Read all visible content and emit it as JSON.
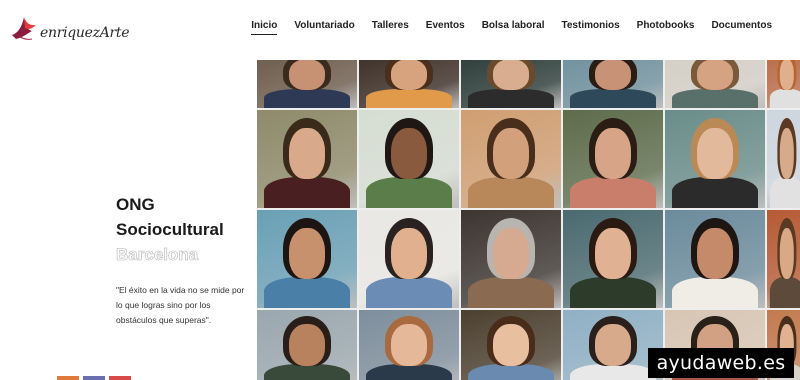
{
  "brand": {
    "name": "enriquezArte"
  },
  "nav": {
    "items": [
      {
        "label": "Inicio",
        "active": true
      },
      {
        "label": "Voluntariado"
      },
      {
        "label": "Talleres"
      },
      {
        "label": "Eventos"
      },
      {
        "label": "Bolsa laboral"
      },
      {
        "label": "Testimonios"
      },
      {
        "label": "Photobooks"
      },
      {
        "label": "Documentos"
      }
    ]
  },
  "hero": {
    "line1": "ONG",
    "line2": "Sociocultural",
    "line3": "Barcelona",
    "quote": "\"El éxito en la vida no se mide por lo que logras sino por los obstáculos que superas\"."
  },
  "watermark": "ayudaweb.es",
  "colors": {
    "logo_bird": "#8b1d3f",
    "logo_wing_accent": "#e23b3b",
    "text_dark": "#1a1a1a",
    "outline_text": "#b8b8b8"
  },
  "photos": [
    {
      "bg": "#6b5a4a",
      "skin": "#c79274",
      "hair": "#3b2a1e",
      "shirt": "#2e3a55"
    },
    {
      "bg": "#3a2c24",
      "skin": "#d7a37f",
      "hair": "#4a2f1c",
      "shirt": "#e09a4a"
    },
    {
      "bg": "#2a3a36",
      "skin": "#d9ad8f",
      "hair": "#6a4a2d",
      "shirt": "#2c2c2c"
    },
    {
      "bg": "#6d8f9c",
      "skin": "#c89276",
      "hair": "#2a1d16",
      "shirt": "#2e4a5a"
    },
    {
      "bg": "#d4cfc6",
      "skin": "#d5a282",
      "hair": "#7a5a3a",
      "shirt": "#59706a"
    },
    {
      "bg": "#b96a46",
      "skin": "#e0b08e",
      "hair": "#b7652e",
      "shirt": "#e0e0e0"
    },
    {
      "bg": "#8e8a6a",
      "skin": "#d8a98a",
      "hair": "#3a2a1a",
      "shirt": "#4a1f22"
    },
    {
      "bg": "#d6ddd2",
      "skin": "#8a5a3e",
      "hair": "#1e1714",
      "shirt": "#5a7d4a"
    },
    {
      "bg": "#d09e72",
      "skin": "#d3a07c",
      "hair": "#4a2e1c",
      "shirt": "#b8875a"
    },
    {
      "bg": "#5d6c4b",
      "skin": "#d7a488",
      "hair": "#2b1c14",
      "shirt": "#c97d6b"
    },
    {
      "bg": "#6a8d8a",
      "skin": "#e3b99b",
      "hair": "#b98a55",
      "shirt": "#2b2b2b"
    },
    {
      "bg": "#cdd5de",
      "skin": "#d8aa8c",
      "hair": "#5a3a22",
      "shirt": "#e1e1e1"
    },
    {
      "bg": "#6aa0b5",
      "skin": "#c7916e",
      "hair": "#1c1512",
      "shirt": "#4a7fa8"
    },
    {
      "bg": "#eae8e4",
      "skin": "#e0b08f",
      "hair": "#2a2220",
      "shirt": "#6b8cb5"
    },
    {
      "bg": "#3c3530",
      "skin": "#d6aa90",
      "hair": "#b8b4ae",
      "shirt": "#8a6a50"
    },
    {
      "bg": "#4a6a70",
      "skin": "#e0b193",
      "hair": "#2a1a12",
      "shirt": "#2d3c2a"
    },
    {
      "bg": "#6b8b9c",
      "skin": "#c48a6a",
      "hair": "#1e1612",
      "shirt": "#f0ede6"
    },
    {
      "bg": "#b65a34",
      "skin": "#d9a885",
      "hair": "#5a3a22",
      "shirt": "#5e4a3a"
    },
    {
      "bg": "#9aa7ae",
      "skin": "#b9825f",
      "hair": "#2a1f18",
      "shirt": "#3a4a3a"
    },
    {
      "bg": "#7e8e9c",
      "skin": "#e4b899",
      "hair": "#a86a3e",
      "shirt": "#2a3a4a"
    },
    {
      "bg": "#4c4030",
      "skin": "#e8c0a0",
      "hair": "#4a2c1a",
      "shirt": "#6a8ab0"
    },
    {
      "bg": "#8fb0c4",
      "skin": "#d8aa8c",
      "hair": "#2a1f1a",
      "shirt": "#e8e8e8"
    },
    {
      "bg": "#d8c6b4",
      "skin": "#d2a184",
      "hair": "#2a201a",
      "shirt": "#a05a4a"
    },
    {
      "bg": "#c27a4e",
      "skin": "#e0b291",
      "hair": "#4a2e1c",
      "shirt": "#d8d2c8"
    }
  ]
}
